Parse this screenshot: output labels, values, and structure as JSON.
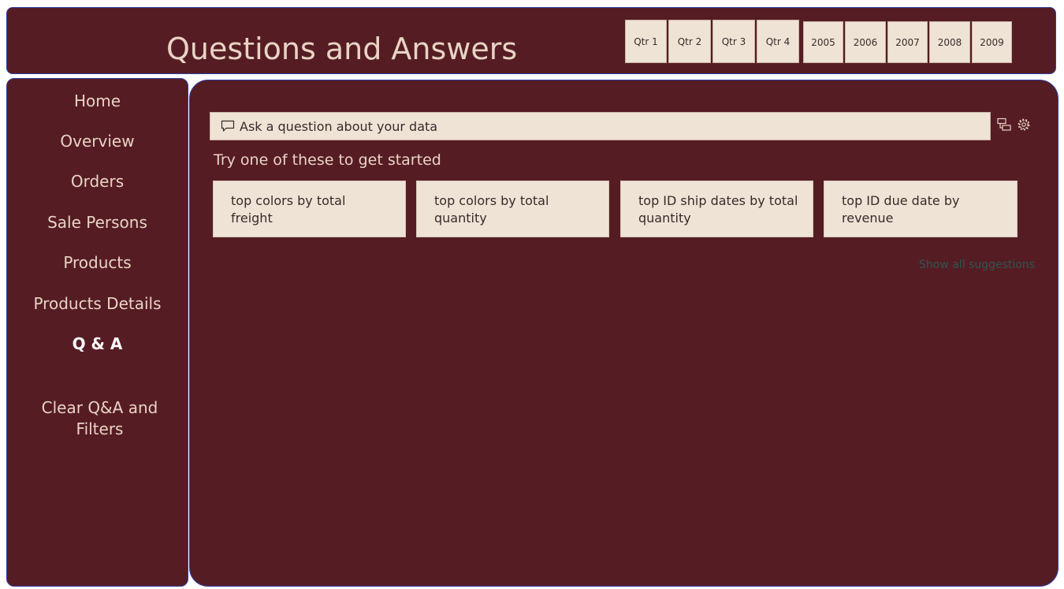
{
  "header": {
    "title": "Questions and Answers",
    "quarters": [
      "Qtr 1",
      "Qtr 2",
      "Qtr 3",
      "Qtr 4"
    ],
    "years": [
      "2005",
      "2006",
      "2007",
      "2008",
      "2009"
    ]
  },
  "sidebar": {
    "items": [
      {
        "label": "Home"
      },
      {
        "label": "Overview"
      },
      {
        "label": "Orders"
      },
      {
        "label": "Sale Persons"
      },
      {
        "label": "Products"
      },
      {
        "label": "Products Details"
      },
      {
        "label": "Q & A"
      }
    ],
    "clear_label_line1": "Clear Q&A and",
    "clear_label_line2": "Filters"
  },
  "qa": {
    "placeholder": "Ask a question about your data",
    "try_label": "Try one of these to get started",
    "suggestions": [
      "top colors by total freight",
      "top colors by total quantity",
      "top ID ship dates by total quantity",
      "top ID due date by revenue"
    ],
    "show_all": "Show all suggestions"
  },
  "colors": {
    "panel_bg": "#561c24",
    "accent_text": "#e8d4c4",
    "button_bg": "#efe3d6",
    "panel_border": "#2f3e9e"
  },
  "icons": {
    "input": "chat-bubble-icon",
    "convert": "convert-visual-icon",
    "settings": "gear-icon"
  }
}
